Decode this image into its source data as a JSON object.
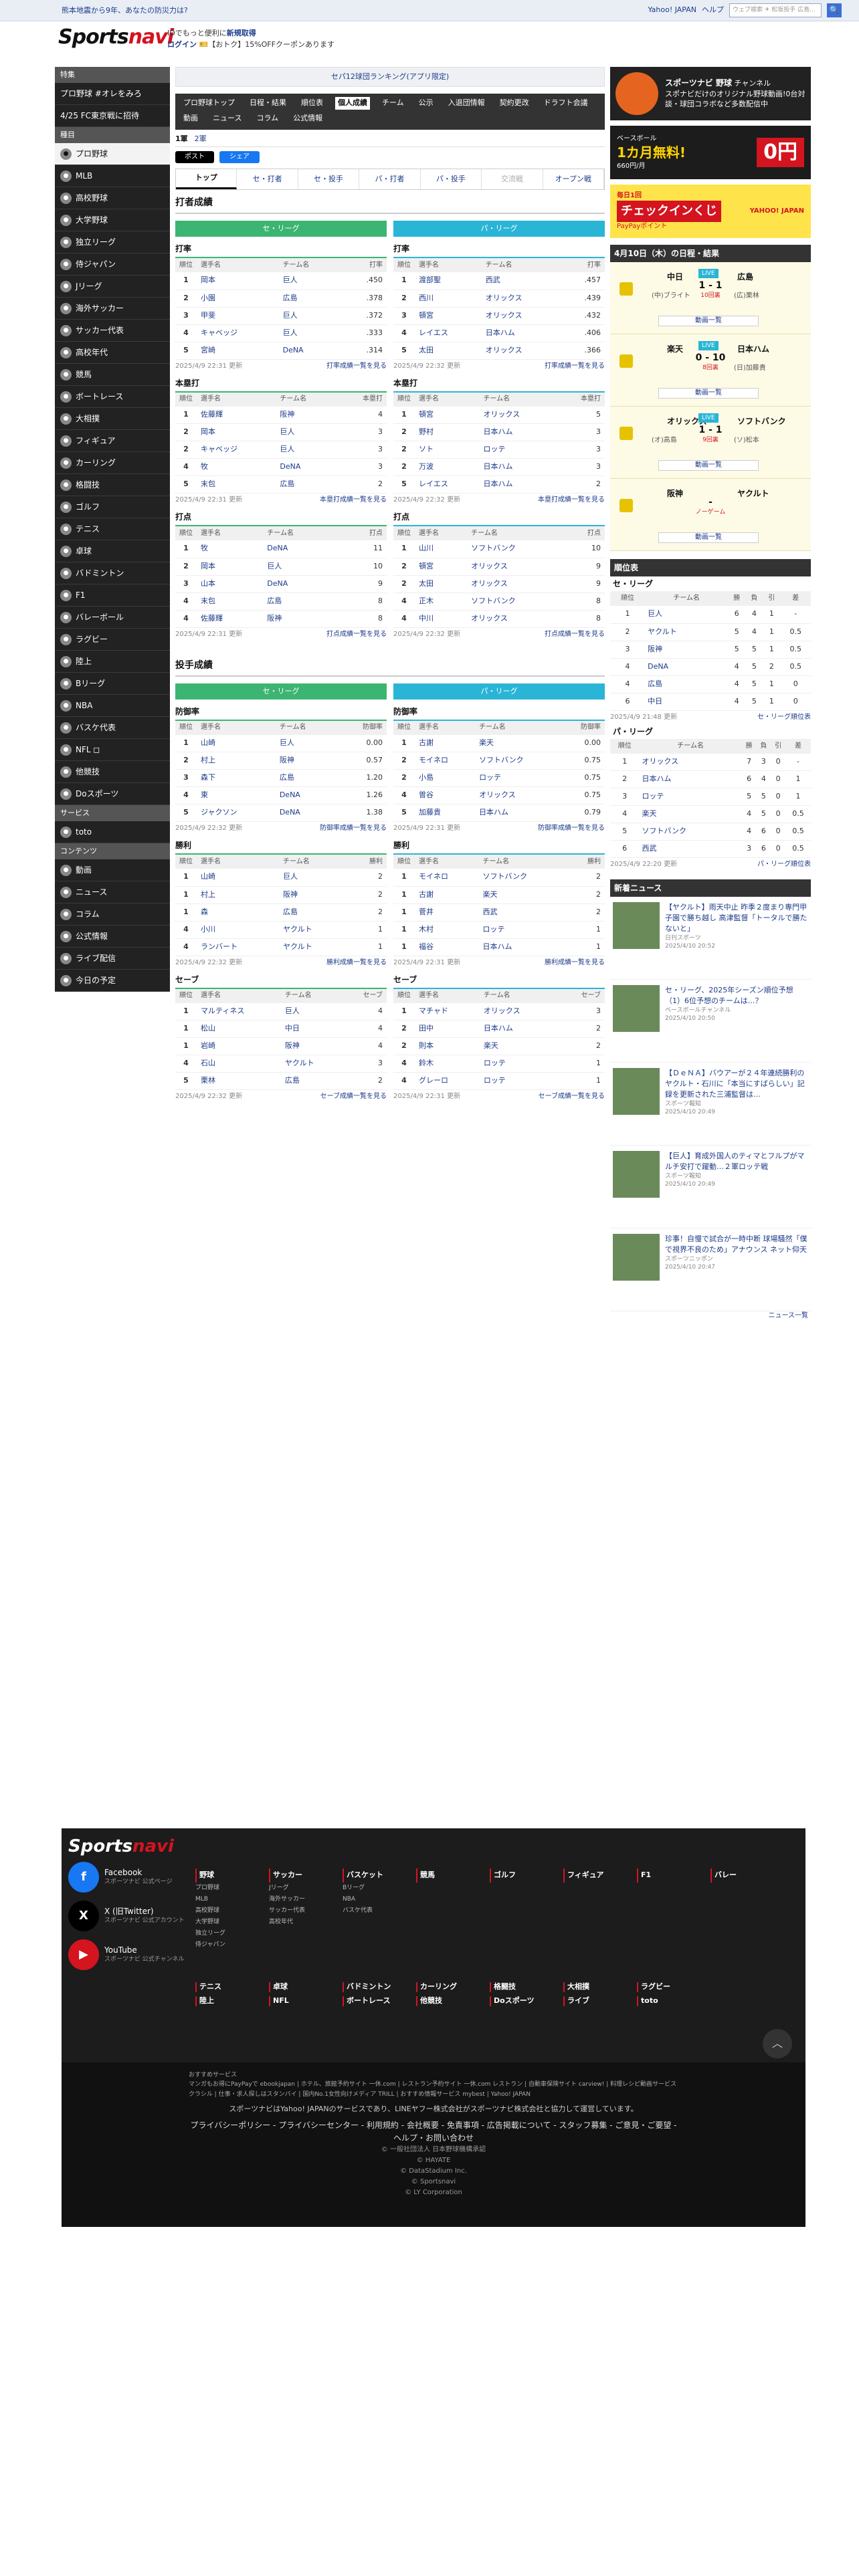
{
  "topbar": {
    "notice": "熊本地震から9年、あなたの防災力は?",
    "yahoo": "Yahoo! JAPAN",
    "help": "ヘルプ",
    "search_ph": "ウェブ検索",
    "search_sel": "✈ 松坂投手 広島..."
  },
  "brand": {
    "logo1": "Sports",
    "logo2": "navi"
  },
  "promo": {
    "line1a": "IDでもっと便利に",
    "line1b": "新規取得",
    "login": "ログイン",
    "line2": "【おトク】15%OFFクーポンあります"
  },
  "sidebar": {
    "h1": "特集",
    "f": [
      "プロ野球 #オレをみろ",
      "4/25 FC東京戦に招待"
    ],
    "h2": "種目",
    "items": [
      "プロ野球",
      "MLB",
      "高校野球",
      "大学野球",
      "独立リーグ",
      "侍ジャパン",
      "Jリーグ",
      "海外サッカー",
      "サッカー代表",
      "高校年代",
      "競馬",
      "ボートレース",
      "大相撲",
      "フィギュア",
      "カーリング",
      "格闘技",
      "ゴルフ",
      "テニス",
      "卓球",
      "バドミントン",
      "F1",
      "バレーボール",
      "ラグビー",
      "陸上",
      "Bリーグ",
      "NBA",
      "バスケ代表",
      "NFL ◻",
      "他競技",
      "Doスポーツ"
    ],
    "h3": "サービス",
    "svc": [
      "toto"
    ],
    "h4": "コンテンツ",
    "cont": [
      "動画",
      "ニュース",
      "コラム",
      "公式情報",
      "ライブ配信",
      "今日の予定"
    ]
  },
  "main": {
    "banner": "セパ12球団ランキング(アプリ限定)",
    "nav": [
      "プロ野球トップ",
      "日程・結果",
      "順位表",
      "個人成績",
      "チーム",
      "公示",
      "入退団情報",
      "契約更改",
      "ドラフト会議",
      "動画",
      "ニュース",
      "コラム",
      "公式情報"
    ],
    "nav_active": "個人成績",
    "years": [
      "1軍",
      "2軍"
    ],
    "share_x": "ポスト",
    "share_fb": "シェア",
    "tabs": [
      "トップ",
      "セ・打者",
      "セ・投手",
      "パ・打者",
      "パ・投手",
      "交流戦",
      "オープン戦"
    ],
    "tab_active": "トップ",
    "sec1": "打者成績",
    "sec2": "投手成績",
    "league_c": "セ・リーグ",
    "league_p": "パ・リーグ"
  },
  "bat": {
    "c": [
      {
        "title": "打率",
        "cols": [
          "順位",
          "選手名",
          "チーム名",
          "打率"
        ],
        "rows": [
          [
            "1",
            "岡本",
            "巨人",
            ".450"
          ],
          [
            "2",
            "小園",
            "広島",
            ".378"
          ],
          [
            "3",
            "甲斐",
            "巨人",
            ".372"
          ],
          [
            "4",
            "キャベッジ",
            "巨人",
            ".333"
          ],
          [
            "5",
            "宮崎",
            "DeNA",
            ".314"
          ]
        ],
        "upd": "2025/4/9 22:31 更新",
        "more": "打率成績一覧を見る"
      },
      {
        "title": "本塁打",
        "cols": [
          "順位",
          "選手名",
          "チーム名",
          "本塁打"
        ],
        "rows": [
          [
            "1",
            "佐藤輝",
            "阪神",
            "4"
          ],
          [
            "2",
            "岡本",
            "巨人",
            "3"
          ],
          [
            "2",
            "キャベッジ",
            "巨人",
            "3"
          ],
          [
            "4",
            "牧",
            "DeNA",
            "3"
          ],
          [
            "5",
            "末包",
            "広島",
            "2"
          ]
        ],
        "upd": "2025/4/9 22:31 更新",
        "more": "本塁打成績一覧を見る"
      },
      {
        "title": "打点",
        "cols": [
          "順位",
          "選手名",
          "チーム名",
          "打点"
        ],
        "rows": [
          [
            "1",
            "牧",
            "DeNA",
            "11"
          ],
          [
            "2",
            "岡本",
            "巨人",
            "10"
          ],
          [
            "3",
            "山本",
            "DeNA",
            "9"
          ],
          [
            "4",
            "末包",
            "広島",
            "8"
          ],
          [
            "4",
            "佐藤輝",
            "阪神",
            "8"
          ]
        ],
        "upd": "2025/4/9 22:31 更新",
        "more": "打点成績一覧を見る"
      }
    ],
    "p": [
      {
        "title": "打率",
        "cols": [
          "順位",
          "選手名",
          "チーム名",
          "打率"
        ],
        "rows": [
          [
            "1",
            "渡部聖",
            "西武",
            ".457"
          ],
          [
            "2",
            "西川",
            "オリックス",
            ".439"
          ],
          [
            "3",
            "頓宮",
            "オリックス",
            ".432"
          ],
          [
            "4",
            "レイエス",
            "日本ハム",
            ".406"
          ],
          [
            "5",
            "太田",
            "オリックス",
            ".366"
          ]
        ],
        "upd": "2025/4/9 22:32 更新",
        "more": "打率成績一覧を見る"
      },
      {
        "title": "本塁打",
        "cols": [
          "順位",
          "選手名",
          "チーム名",
          "本塁打"
        ],
        "rows": [
          [
            "1",
            "頓宮",
            "オリックス",
            "5"
          ],
          [
            "2",
            "野村",
            "日本ハム",
            "3"
          ],
          [
            "2",
            "ソト",
            "ロッテ",
            "3"
          ],
          [
            "2",
            "万波",
            "日本ハム",
            "3"
          ],
          [
            "5",
            "レイエス",
            "日本ハム",
            "2"
          ]
        ],
        "upd": "2025/4/9 22:32 更新",
        "more": "本塁打成績一覧を見る"
      },
      {
        "title": "打点",
        "cols": [
          "順位",
          "選手名",
          "チーム名",
          "打点"
        ],
        "rows": [
          [
            "1",
            "山川",
            "ソフトバンク",
            "10"
          ],
          [
            "2",
            "頓宮",
            "オリックス",
            "9"
          ],
          [
            "2",
            "太田",
            "オリックス",
            "9"
          ],
          [
            "4",
            "正木",
            "ソフトバンク",
            "8"
          ],
          [
            "4",
            "中川",
            "オリックス",
            "8"
          ]
        ],
        "upd": "2025/4/9 22:32 更新",
        "more": "打点成績一覧を見る"
      }
    ]
  },
  "pit": {
    "c": [
      {
        "title": "防御率",
        "cols": [
          "順位",
          "選手名",
          "チーム名",
          "防御率"
        ],
        "rows": [
          [
            "1",
            "山崎",
            "巨人",
            "0.00"
          ],
          [
            "2",
            "村上",
            "阪神",
            "0.57"
          ],
          [
            "3",
            "森下",
            "広島",
            "1.20"
          ],
          [
            "4",
            "東",
            "DeNA",
            "1.26"
          ],
          [
            "5",
            "ジャクソン",
            "DeNA",
            "1.38"
          ]
        ],
        "upd": "2025/4/9 22:32 更新",
        "more": "防御率成績一覧を見る"
      },
      {
        "title": "勝利",
        "cols": [
          "順位",
          "選手名",
          "チーム名",
          "勝利"
        ],
        "rows": [
          [
            "1",
            "山崎",
            "巨人",
            "2"
          ],
          [
            "1",
            "村上",
            "阪神",
            "2"
          ],
          [
            "1",
            "森",
            "広島",
            "2"
          ],
          [
            "4",
            "小川",
            "ヤクルト",
            "1"
          ],
          [
            "4",
            "ランバート",
            "ヤクルト",
            "1"
          ]
        ],
        "upd": "2025/4/9 22:32 更新",
        "more": "勝利成績一覧を見る"
      },
      {
        "title": "セーブ",
        "cols": [
          "順位",
          "選手名",
          "チーム名",
          "セーブ"
        ],
        "rows": [
          [
            "1",
            "マルティネス",
            "巨人",
            "4"
          ],
          [
            "1",
            "松山",
            "中日",
            "4"
          ],
          [
            "1",
            "岩崎",
            "阪神",
            "4"
          ],
          [
            "4",
            "石山",
            "ヤクルト",
            "3"
          ],
          [
            "5",
            "栗林",
            "広島",
            "2"
          ]
        ],
        "upd": "2025/4/9 22:32 更新",
        "more": "セーブ成績一覧を見る"
      }
    ],
    "p": [
      {
        "title": "防御率",
        "cols": [
          "順位",
          "選手名",
          "チーム名",
          "防御率"
        ],
        "rows": [
          [
            "1",
            "古謝",
            "楽天",
            "0.00"
          ],
          [
            "2",
            "モイネロ",
            "ソフトバンク",
            "0.75"
          ],
          [
            "2",
            "小島",
            "ロッテ",
            "0.75"
          ],
          [
            "4",
            "曽谷",
            "オリックス",
            "0.75"
          ],
          [
            "5",
            "加藤貴",
            "日本ハム",
            "0.79"
          ]
        ],
        "upd": "2025/4/9 22:31 更新",
        "more": "防御率成績一覧を見る"
      },
      {
        "title": "勝利",
        "cols": [
          "順位",
          "選手名",
          "チーム名",
          "勝利"
        ],
        "rows": [
          [
            "1",
            "モイネロ",
            "ソフトバンク",
            "2"
          ],
          [
            "1",
            "古謝",
            "楽天",
            "2"
          ],
          [
            "1",
            "菅井",
            "西武",
            "2"
          ],
          [
            "1",
            "木村",
            "ロッテ",
            "1"
          ],
          [
            "1",
            "福谷",
            "日本ハム",
            "1"
          ]
        ],
        "upd": "2025/4/9 22:31 更新",
        "more": "勝利成績一覧を見る"
      },
      {
        "title": "セーブ",
        "cols": [
          "順位",
          "選手名",
          "チーム名",
          "セーブ"
        ],
        "rows": [
          [
            "1",
            "マチャド",
            "オリックス",
            "3"
          ],
          [
            "2",
            "田中",
            "日本ハム",
            "2"
          ],
          [
            "2",
            "則本",
            "楽天",
            "2"
          ],
          [
            "4",
            "鈴木",
            "ロッテ",
            "1"
          ],
          [
            "4",
            "グレーロ",
            "ロッテ",
            "1"
          ]
        ],
        "upd": "2025/4/9 22:31 更新",
        "more": "セーブ成績一覧を見る"
      }
    ]
  },
  "right": {
    "ad1_title": "スポーツナビ 野球",
    "ad1_sub": "チャンネル",
    "ad1_text": "スポナビだけのオリジナル野球動画!0台対談・球団コラボなど多数配信中",
    "ad2_a": "ベースボール",
    "ad2_b": "1カ月無料!",
    "ad2_c": "660円/月",
    "ad2_zero": "0円",
    "ad3_a": "毎日1回",
    "ad3_b": "チェックインくじ",
    "ad3_c": "PayPayポイント",
    "ad3_y": "YAHOO! JAPAN",
    "games_head": "4月10日（木）の日程・結果",
    "games": [
      {
        "t1": "中日",
        "t2": "広島",
        "live": "LIVE",
        "score": "1 - 1",
        "inn": "10回裏",
        "p1": "(中)ブライト",
        "p2": "(広)栗林",
        "v": "動画一覧"
      },
      {
        "t1": "楽天",
        "t2": "日本ハム",
        "live": "LIVE",
        "score": "0 - 10",
        "inn": "8回裏",
        "p1": "",
        "p2": "(日)加藤貴",
        "v": "動画一覧"
      },
      {
        "t1": "オリックス",
        "t2": "ソフトバンク",
        "live": "LIVE",
        "score": "1 - 1",
        "inn": "9回裏",
        "p1": "(オ)高島",
        "p2": "(ソ)松本",
        "v": "動画一覧"
      },
      {
        "t1": "阪神",
        "t2": "ヤクルト",
        "live": "",
        "score": "-",
        "inn": "ノーゲーム",
        "p1": "",
        "p2": "",
        "v": "動画一覧"
      }
    ],
    "stand_head": "順位表",
    "stand_c": {
      "title": "セ・リーグ",
      "cols": [
        "順位",
        "チーム名",
        "勝",
        "負",
        "引",
        "差"
      ],
      "rows": [
        [
          "1",
          "巨人",
          "6",
          "4",
          "1",
          "-"
        ],
        [
          "2",
          "ヤクルト",
          "5",
          "4",
          "1",
          "0.5"
        ],
        [
          "3",
          "阪神",
          "5",
          "5",
          "1",
          "0.5"
        ],
        [
          "4",
          "DeNA",
          "4",
          "5",
          "2",
          "0.5"
        ],
        [
          "4",
          "広島",
          "4",
          "5",
          "1",
          "0"
        ],
        [
          "6",
          "中日",
          "4",
          "5",
          "1",
          "0"
        ]
      ],
      "upd": "2025/4/9 21:48 更新",
      "more": "セ・リーグ順位表"
    },
    "stand_p": {
      "title": "パ・リーグ",
      "cols": [
        "順位",
        "チーム名",
        "勝",
        "負",
        "引",
        "差"
      ],
      "rows": [
        [
          "1",
          "オリックス",
          "7",
          "3",
          "0",
          "-"
        ],
        [
          "2",
          "日本ハム",
          "6",
          "4",
          "0",
          "1"
        ],
        [
          "3",
          "ロッテ",
          "5",
          "5",
          "0",
          "1"
        ],
        [
          "4",
          "楽天",
          "4",
          "5",
          "0",
          "0.5"
        ],
        [
          "5",
          "ソフトバンク",
          "4",
          "6",
          "0",
          "0.5"
        ],
        [
          "6",
          "西武",
          "3",
          "6",
          "0",
          "0.5"
        ]
      ],
      "upd": "2025/4/9 22:20 更新",
      "more": "パ・リーグ順位表"
    },
    "news_head": "新着ニュース",
    "news": [
      {
        "t": "【ヤクルト】雨天中止 昨季２度まり専門甲子園で勝ち越し 高津監督「トータルで勝たないと」",
        "s": "日刊スポーツ",
        "d": "2025/4/10 20:52"
      },
      {
        "t": "セ・リーグ、2025年シーズン順位予想（1）6位予想のチームは…？",
        "s": "ベースボールチャンネル",
        "d": "2025/4/10 20:50"
      },
      {
        "t": "【ＤｅＮＡ】バウアーが２４年連続勝利のヤクルト・石川に「本当にすばらしい」記録を更新された三浦監督は…",
        "s": "スポーツ報知",
        "d": "2025/4/10 20:49"
      },
      {
        "t": "【巨人】育成外国人のティマとフルプがマルチ安打で躍動…２軍ロッテ戦",
        "s": "スポーツ報知",
        "d": "2025/4/10 20:49"
      },
      {
        "t": "珍事！自慢で試合が一時中断 球場騒然「僕で視界不良のため」アナウンス ネット仰天",
        "s": "スポーツニッポン",
        "d": "2025/4/10 20:47"
      }
    ],
    "news_more": "ニュース一覧"
  },
  "footer": {
    "logo1": "Sports",
    "logo2": "navi",
    "social": [
      {
        "n": "Facebook",
        "s": "スポーツナビ 公式ページ",
        "c": "#1877f2",
        "g": "f"
      },
      {
        "n": "X (旧Twitter)",
        "s": "スポーツナビ 公式アカウント",
        "c": "#000",
        "g": "X"
      },
      {
        "n": "YouTube",
        "s": "スポーツナビ 公式チャンネル",
        "c": "#d4141f",
        "g": "▶"
      }
    ],
    "cols": [
      {
        "h": "野球",
        "i": [
          "プロ野球",
          "MLB",
          "高校野球",
          "大学野球",
          "独立リーグ",
          "侍ジャパン"
        ]
      },
      {
        "h": "サッカー",
        "i": [
          "Jリーグ",
          "海外サッカー",
          "サッカー代表",
          "高校年代"
        ]
      },
      {
        "h": "バスケット",
        "i": [
          "Bリーグ",
          "NBA",
          "バスケ代表"
        ]
      },
      {
        "h": "競馬",
        "i": []
      },
      {
        "h": "ゴルフ",
        "i": []
      },
      {
        "h": "フィギュア",
        "i": []
      },
      {
        "h": "F1",
        "i": []
      },
      {
        "h": "バレー",
        "i": []
      }
    ],
    "cols2": [
      "テニス",
      "卓球",
      "バドミントン",
      "カーリング",
      "格闘技",
      "大相撲",
      "ラグビー",
      "陸上",
      "NFL",
      "ボートレース",
      "他競技",
      "Doスポーツ",
      "ライブ",
      "toto"
    ],
    "svc_head": "おすすめサービス",
    "svc_text": "マンガもお得にPayPayで ebookjapan | ホテル、旅館予約サイト 一休.com | レストラン予約サイト 一休.com レストラン | 自動車保険サイト carview! | 料理レシピ動画サービス クラシル | 仕事・求人探しはスタンバイ | 国内No.1女性向けメディア TRILL | おすすめ情報サービス mybest | Yahoo! JAPAN",
    "corp": "スポーツナビはYahoo! JAPANのサービスであり、LINEヤフー株式会社がスポーツナビ株式会社と協力して運営しています。",
    "links": "プライバシーポリシー - プライバシーセンター - 利用規約 - 会社概要 - 免責事項 - 広告掲載について - スタッフ募集 - ご意見・ご要望 - ヘルプ・お問い合わせ",
    "copy": [
      "© 一般社団法人 日本野球機構承認",
      "© HAYATE",
      "© DataStadium Inc.",
      "© Sportsnavi",
      "© LY Corporation"
    ]
  }
}
